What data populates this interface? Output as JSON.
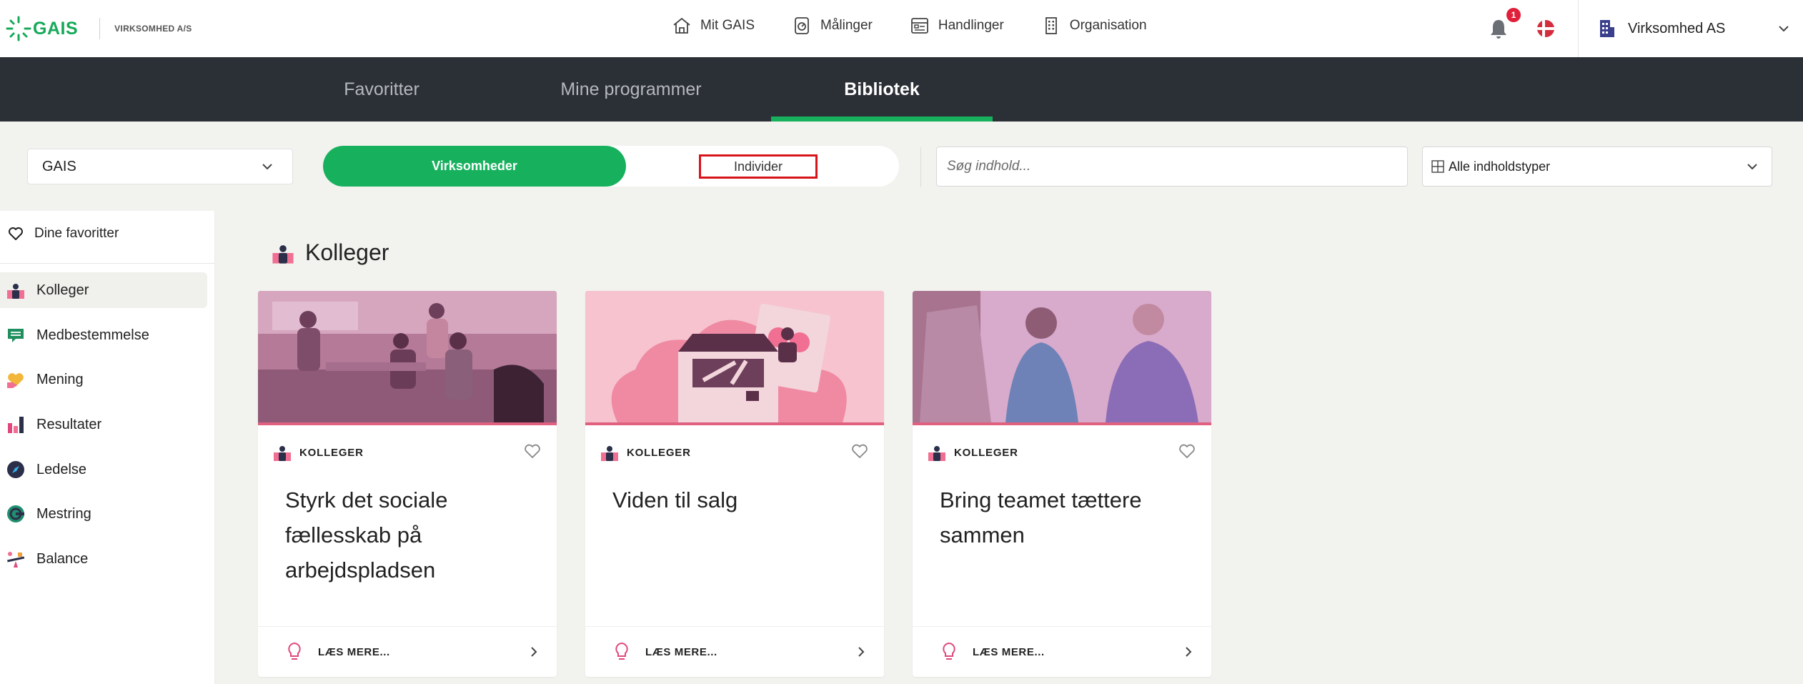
{
  "header": {
    "brand": "GAIS",
    "company_label": "VIRKSOMHED A/S",
    "nav": [
      {
        "label": "Mit GAIS",
        "icon": "house-icon"
      },
      {
        "label": "Målinger",
        "icon": "measurement-icon"
      },
      {
        "label": "Handlinger",
        "icon": "actions-icon"
      },
      {
        "label": "Organisation",
        "icon": "building-icon"
      }
    ],
    "notification_count": "1",
    "language_icon": "danish-flag-icon",
    "company_name": "Virksomhed AS"
  },
  "tabs": [
    {
      "label": "Favoritter",
      "active": false
    },
    {
      "label": "Mine programmer",
      "active": false
    },
    {
      "label": "Bibliotek",
      "active": true
    }
  ],
  "filters": {
    "org_select": "GAIS",
    "segment_a": "Virksomheder",
    "segment_b": "Individer",
    "search_placeholder": "Søg indhold...",
    "type_select": "Alle indholdstyper"
  },
  "sidebar": {
    "favorites_label": "Dine favoritter",
    "items": [
      {
        "label": "Kolleger",
        "icon": "colleagues-icon",
        "active": true
      },
      {
        "label": "Medbestemmelse",
        "icon": "chat-icon",
        "active": false
      },
      {
        "label": "Mening",
        "icon": "heart-hand-icon",
        "active": false
      },
      {
        "label": "Resultater",
        "icon": "bar-chart-icon",
        "active": false
      },
      {
        "label": "Ledelse",
        "icon": "compass-icon",
        "active": false
      },
      {
        "label": "Mestring",
        "icon": "mastery-icon",
        "active": false
      },
      {
        "label": "Balance",
        "icon": "balance-icon",
        "active": false
      }
    ]
  },
  "section": {
    "title": "Kolleger"
  },
  "cards": [
    {
      "tag": "KOLLEGER",
      "title": "Styrk det sociale fællesskab på arbejdspladsen",
      "more": "LÆS MERE...",
      "image": "office-team-photo"
    },
    {
      "tag": "KOLLEGER",
      "title": "Viden til salg",
      "more": "LÆS MERE...",
      "image": "toolbox-illustration"
    },
    {
      "tag": "KOLLEGER",
      "title": "Bring teamet tættere sammen",
      "more": "LÆS MERE...",
      "image": "colleagues-talking-photo"
    }
  ],
  "colors": {
    "accent_green": "#17b15e",
    "dark_bar": "#2b2f36",
    "pink": "#e0607f",
    "highlight_red": "#d8141b"
  }
}
